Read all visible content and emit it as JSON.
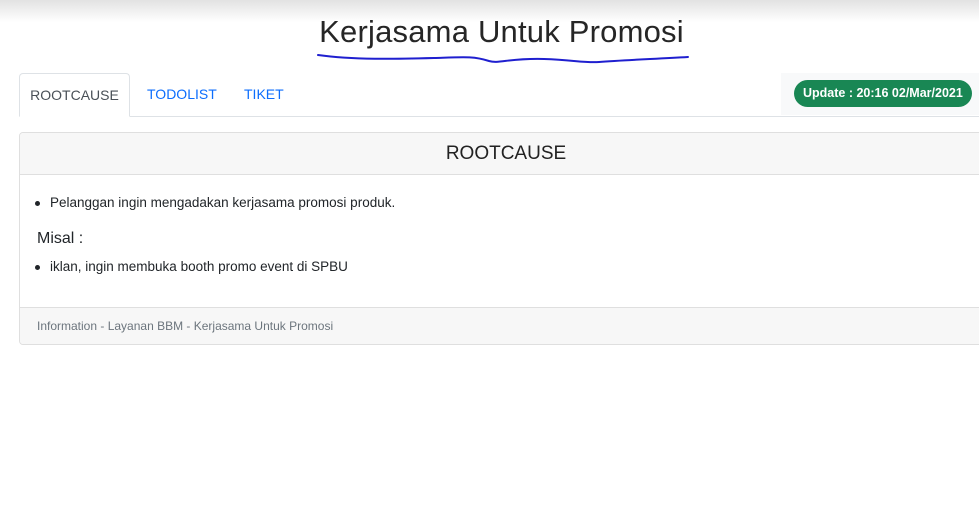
{
  "header": {
    "title": "Kerjasama Untuk Promosi"
  },
  "tabs": [
    {
      "label": "ROOTCAUSE",
      "active": true
    },
    {
      "label": "TODOLIST",
      "active": false
    },
    {
      "label": "TIKET",
      "active": false
    }
  ],
  "update_badge": {
    "text": "Update : 20:16 02/Mar/2021",
    "color": "#198754"
  },
  "card": {
    "header": "ROOTCAUSE",
    "bullets_primary": [
      "Pelanggan ingin mengadakan kerjasama promosi produk."
    ],
    "subheading": "Misal :",
    "bullets_secondary": [
      "iklan, ingin membuka booth promo event di SPBU"
    ],
    "footer": "Information - Layanan BBM - Kerjasama Untuk Promosi"
  },
  "colors": {
    "link": "#0d6efd",
    "scribble": "#1f1fcf"
  }
}
